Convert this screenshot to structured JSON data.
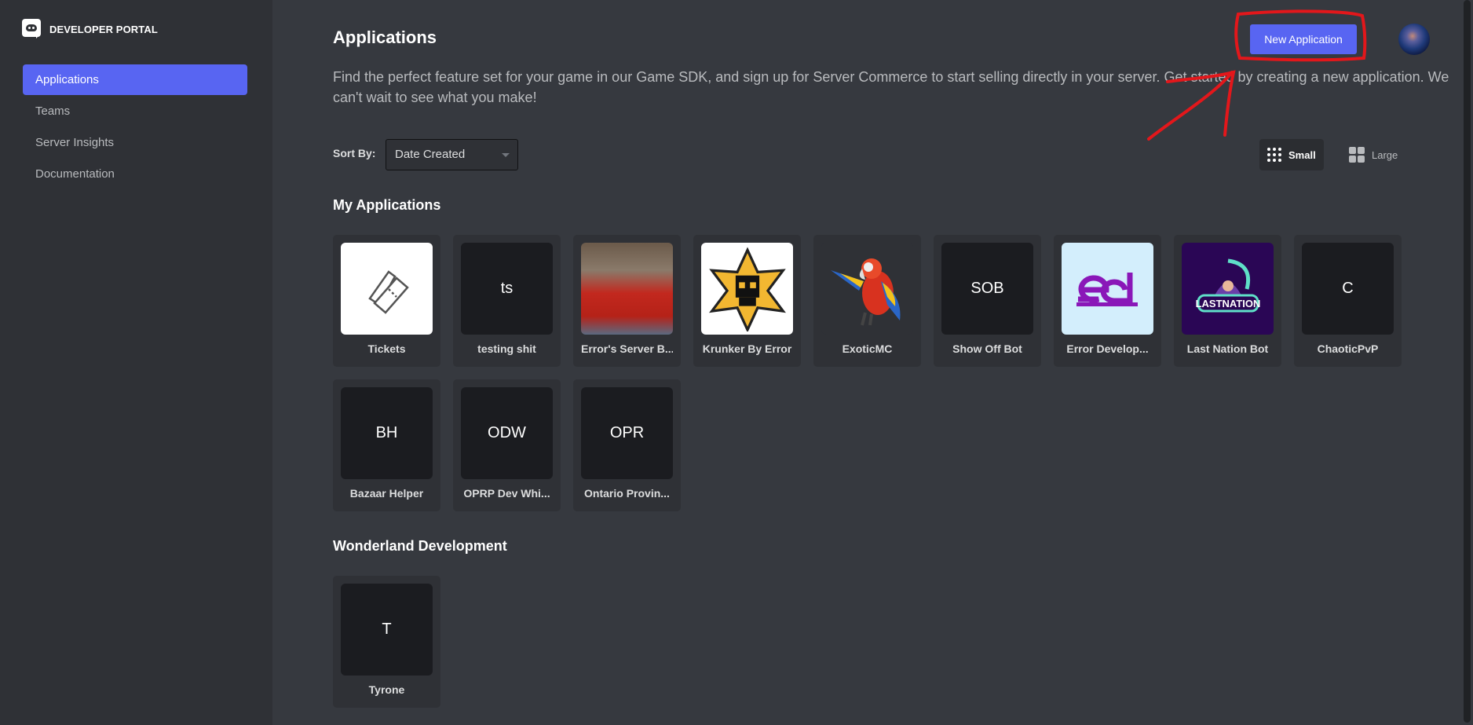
{
  "brand": {
    "name": "DEVELOPER PORTAL",
    "icon": "discord-logo-icon"
  },
  "sidebar": {
    "items": [
      {
        "label": "Applications",
        "active": true
      },
      {
        "label": "Teams",
        "active": false
      },
      {
        "label": "Server Insights",
        "active": false
      },
      {
        "label": "Documentation",
        "active": false
      }
    ]
  },
  "header": {
    "title": "Applications",
    "description": "Find the perfect feature set for your game in our Game SDK, and sign up for Server Commerce to start selling directly in your server. Get started by creating a new application. We can't wait to see what you make!",
    "new_application_label": "New Application",
    "avatar": "user-avatar"
  },
  "sort": {
    "label": "Sort By:",
    "selected": "Date Created"
  },
  "view": {
    "small_label": "Small",
    "large_label": "Large",
    "selected": "Small"
  },
  "colors": {
    "accent": "#5865f2",
    "annotation": "#e3171b"
  },
  "sections": [
    {
      "title": "My Applications",
      "apps": [
        {
          "name": "Tickets",
          "icon": "ticket-icon",
          "initials": ""
        },
        {
          "name": "testing shit",
          "icon": "initials",
          "initials": "ts"
        },
        {
          "name": "Error's Server B...",
          "icon": "photo-avatar",
          "initials": ""
        },
        {
          "name": "Krunker By Error",
          "icon": "skull-star-icon",
          "initials": ""
        },
        {
          "name": "ExoticMC",
          "icon": "parrot-icon",
          "initials": ""
        },
        {
          "name": "Show Off Bot",
          "icon": "initials",
          "initials": "SOB"
        },
        {
          "name": "Error Develop...",
          "icon": "ed-logo-icon",
          "initials": ""
        },
        {
          "name": "Last Nation Bot",
          "icon": "lastnation-logo-icon",
          "initials": ""
        },
        {
          "name": "ChaoticPvP",
          "icon": "initials",
          "initials": "C"
        },
        {
          "name": "Bazaar Helper",
          "icon": "initials",
          "initials": "BH"
        },
        {
          "name": "OPRP Dev Whi...",
          "icon": "initials",
          "initials": "ODW"
        },
        {
          "name": "Ontario Provin...",
          "icon": "initials",
          "initials": "OPR"
        }
      ]
    },
    {
      "title": "Wonderland Development",
      "apps": [
        {
          "name": "Tyrone",
          "icon": "initials",
          "initials": "T"
        }
      ]
    }
  ]
}
